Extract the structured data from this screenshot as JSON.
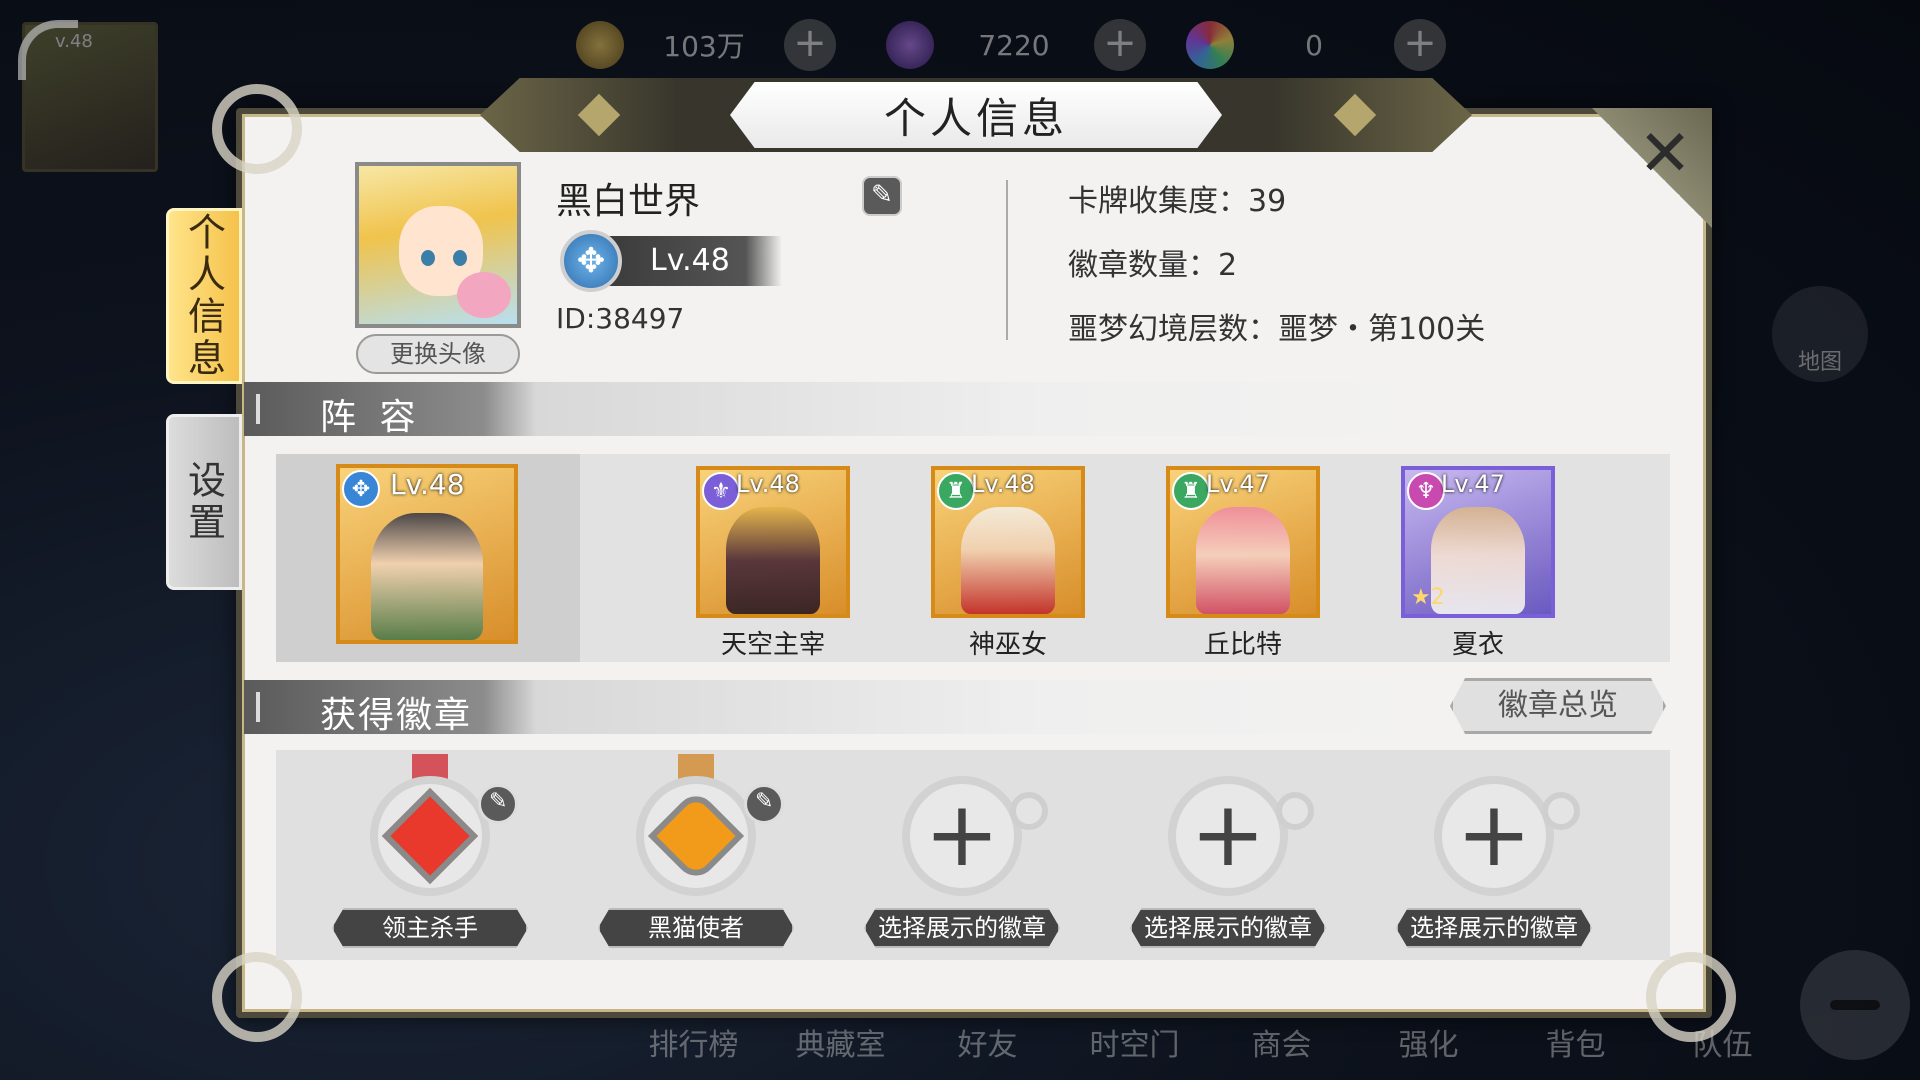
{
  "hud": {
    "avatar_level": "v.48",
    "currencies": [
      {
        "icon": "gold-coin-icon",
        "value": "103万"
      },
      {
        "icon": "purple-gem-icon",
        "value": "7220"
      },
      {
        "icon": "rainbow-orb-icon",
        "value": "0"
      }
    ],
    "side_buttons": [
      "地图"
    ],
    "bottom_nav": [
      "排行榜",
      "典藏室",
      "好友",
      "时空门",
      "商会",
      "强化",
      "背包",
      "队伍"
    ]
  },
  "panel": {
    "title": "个人信息",
    "close_label": "✕",
    "tabs": [
      {
        "label": "个人信息",
        "active": true
      },
      {
        "label": "设置",
        "active": false
      }
    ]
  },
  "profile": {
    "name": "黑白世界",
    "level": "Lv.48",
    "id_text": "ID:38497",
    "change_avatar_label": "更换头像",
    "stats": [
      "卡牌收集度：39",
      "徽章数量：2",
      "噩梦幻境层数：噩梦・第100关"
    ]
  },
  "lineup": {
    "header": "阵 容",
    "leader": {
      "level": "Lv.48",
      "element": "blue"
    },
    "heroes": [
      {
        "name": "天空主宰",
        "level": "Lv.48",
        "element": "purple"
      },
      {
        "name": "神巫女",
        "level": "Lv.48",
        "element": "green"
      },
      {
        "name": "丘比特",
        "level": "Lv.47",
        "element": "green"
      },
      {
        "name": "夏衣",
        "level": "Lv.47",
        "element": "pink",
        "stars": "★2"
      }
    ]
  },
  "badges": {
    "header": "获得徽章",
    "overview_label": "徽章总览",
    "slots": [
      {
        "label": "领主杀手",
        "filled": true,
        "gem_color": "#e8392c"
      },
      {
        "label": "黑猫使者",
        "filled": true,
        "gem_color": "#f29a1a"
      },
      {
        "label": "选择展示的徽章",
        "filled": false
      },
      {
        "label": "选择展示的徽章",
        "filled": false
      },
      {
        "label": "选择展示的徽章",
        "filled": false
      }
    ]
  },
  "colors": {
    "accent_gold": "#f5c24a",
    "card_orange": "#d68a18",
    "card_purple": "#7a5fd8"
  }
}
